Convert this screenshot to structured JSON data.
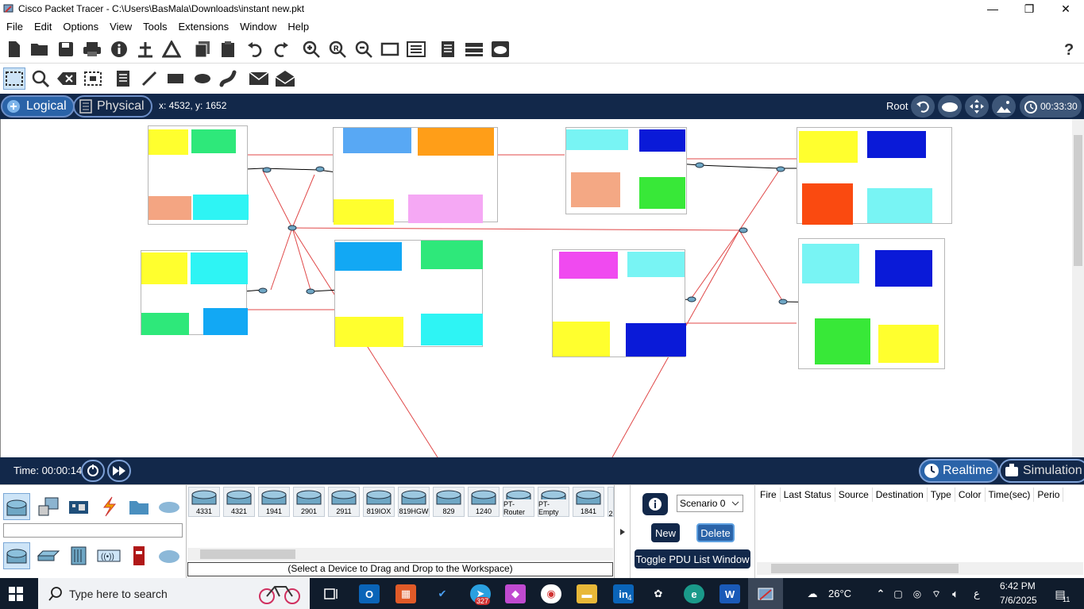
{
  "window": {
    "title": "Cisco Packet Tracer - C:\\Users\\BasMala\\Downloads\\instant new.pkt",
    "minimize": "—",
    "maximize": "❐",
    "close": "✕"
  },
  "menu": [
    "File",
    "Edit",
    "Options",
    "View",
    "Tools",
    "Extensions",
    "Window",
    "Help"
  ],
  "toolbar1_icons": [
    "new-icon",
    "open-icon",
    "save-icon",
    "print-icon",
    "info-icon",
    "network-wizard-icon",
    "activity-wizard-icon",
    "copy-icon",
    "paste-icon",
    "undo-icon",
    "redo-icon",
    "zoom-in-icon",
    "zoom-reset-icon",
    "zoom-out-icon",
    "rectangle-icon",
    "custom-device-icon",
    "notes-icon",
    "device-template-icon",
    "cloud-icon",
    "help-icon"
  ],
  "toolbar2_icons": [
    "select-icon",
    "inspect-icon",
    "delete-icon",
    "resize-icon",
    "note-icon",
    "line-icon",
    "rectangle-draw-icon",
    "ellipse-icon",
    "freeform-icon",
    "simple-pdu-icon",
    "complex-pdu-icon"
  ],
  "workspace": {
    "logical_label": "Logical",
    "physical_label": "Physical",
    "coords": "x: 4532, y: 1652",
    "root_label": "Root",
    "clock": "00:33:30"
  },
  "timebar": {
    "time": "Time: 00:00:14",
    "realtime_label": "Realtime",
    "simulation_label": "Simulation"
  },
  "devices": [
    "4331",
    "4321",
    "1941",
    "2901",
    "2911",
    "819IOX",
    "819HGW",
    "829",
    "1240",
    "PT-Router",
    "PT-Empty",
    "1841",
    "2"
  ],
  "device_hint": "(Select a Device to Drag and Drop to the Workspace)",
  "scenario": {
    "selected": "Scenario 0",
    "new_label": "New",
    "delete_label": "Delete",
    "toggle_label": "Toggle PDU List Window"
  },
  "pdu_columns": [
    "Fire",
    "Last Status",
    "Source",
    "Destination",
    "Type",
    "Color",
    "Time(sec)",
    "Perio"
  ],
  "taskbar": {
    "search_placeholder": "Type here to search",
    "telegram_badge": "327",
    "linkedin_badge": "4",
    "temperature": "26°C",
    "lang": "ع",
    "time": "6:42 PM",
    "date": "7/6/2025",
    "notif_count": "11"
  },
  "colors": {
    "navy": "#12284a",
    "link_red": "#e03030"
  }
}
